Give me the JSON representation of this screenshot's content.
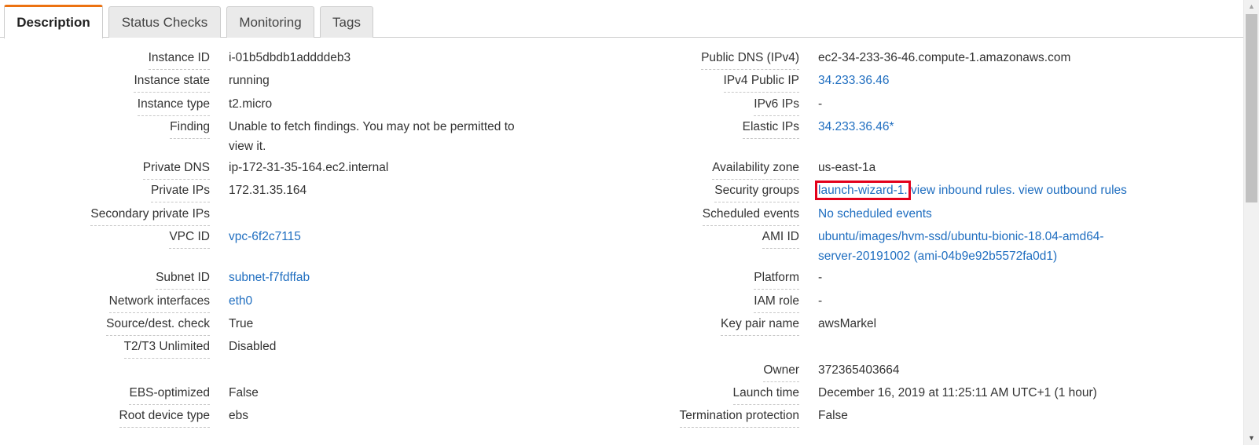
{
  "tabs": [
    {
      "label": "Description"
    },
    {
      "label": "Status Checks"
    },
    {
      "label": "Monitoring"
    },
    {
      "label": "Tags"
    }
  ],
  "left": {
    "instance_id": {
      "label": "Instance ID",
      "value": "i-01b5dbdb1addddeb3"
    },
    "instance_state": {
      "label": "Instance state",
      "value": "running"
    },
    "instance_type": {
      "label": "Instance type",
      "value": "t2.micro"
    },
    "finding": {
      "label": "Finding",
      "value_line1": "Unable to fetch findings. You may not be permitted to",
      "value_line2": "view it."
    },
    "private_dns": {
      "label": "Private DNS",
      "value": "ip-172-31-35-164.ec2.internal"
    },
    "private_ips": {
      "label": "Private IPs",
      "value": "172.31.35.164"
    },
    "secondary_private_ips": {
      "label": "Secondary private IPs",
      "value": ""
    },
    "vpc_id": {
      "label": "VPC ID",
      "value": "vpc-6f2c7115"
    },
    "subnet_id": {
      "label": "Subnet ID",
      "value": "subnet-f7fdffab"
    },
    "network_interfaces": {
      "label": "Network interfaces",
      "value": "eth0"
    },
    "source_dest_check": {
      "label": "Source/dest. check",
      "value": "True"
    },
    "t2t3_unlimited": {
      "label": "T2/T3 Unlimited",
      "value": "Disabled"
    },
    "ebs_optimized": {
      "label": "EBS-optimized",
      "value": "False"
    },
    "root_device_type": {
      "label": "Root device type",
      "value": "ebs"
    }
  },
  "right": {
    "public_dns": {
      "label": "Public DNS (IPv4)",
      "value": "ec2-34-233-36-46.compute-1.amazonaws.com"
    },
    "ipv4_public_ip": {
      "label": "IPv4 Public IP",
      "value": "34.233.36.46"
    },
    "ipv6_ips": {
      "label": "IPv6 IPs",
      "value": "-"
    },
    "elastic_ips": {
      "label": "Elastic IPs",
      "value": "34.233.36.46*"
    },
    "availability_zone": {
      "label": "Availability zone",
      "value": "us-east-1a"
    },
    "security_groups": {
      "label": "Security groups",
      "group": "launch-wizard-1.",
      "inbound": "view inbound rules.",
      "outbound": "view outbound rules"
    },
    "scheduled_events": {
      "label": "Scheduled events",
      "value": "No scheduled events"
    },
    "ami_id": {
      "label": "AMI ID",
      "value_line1": "ubuntu/images/hvm-ssd/ubuntu-bionic-18.04-amd64-",
      "value_line2": "server-20191002 (ami-04b9e92b5572fa0d1)"
    },
    "platform": {
      "label": "Platform",
      "value": "-"
    },
    "iam_role": {
      "label": "IAM role",
      "value": "-"
    },
    "key_pair_name": {
      "label": "Key pair name",
      "value": "awsMarkel"
    },
    "owner": {
      "label": "Owner",
      "value": "372365403664"
    },
    "launch_time": {
      "label": "Launch time",
      "value": "December 16, 2019 at 11:25:11 AM UTC+1 (1 hour)"
    },
    "termination_protection": {
      "label": "Termination protection",
      "value": "False"
    }
  },
  "colors": {
    "accent_tab": "#ec7211",
    "link": "#1f6ec0",
    "highlight": "#e3001b"
  }
}
